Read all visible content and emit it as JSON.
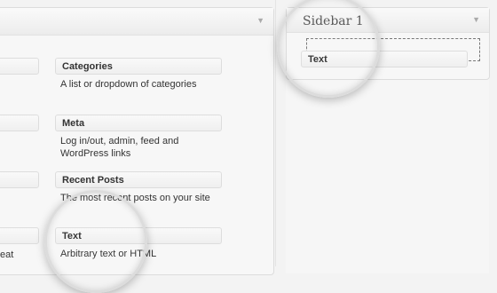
{
  "sidebar": {
    "title": "Sidebar 1",
    "text_widget": "Text"
  },
  "widgets": [
    {
      "name": "Categories",
      "description": "A list or dropdown of categories"
    },
    {
      "name": "Meta",
      "description": "Log in/out, admin, feed and WordPress links"
    },
    {
      "name": "Recent Posts",
      "description": "The most recent posts on your site"
    },
    {
      "name": "Text",
      "description": "Arbitrary text or HTML"
    }
  ],
  "left_column_partial": {
    "last_desc_fragment": "eat"
  },
  "icons": {
    "collapse_arrow": "triangle-down-icon"
  }
}
